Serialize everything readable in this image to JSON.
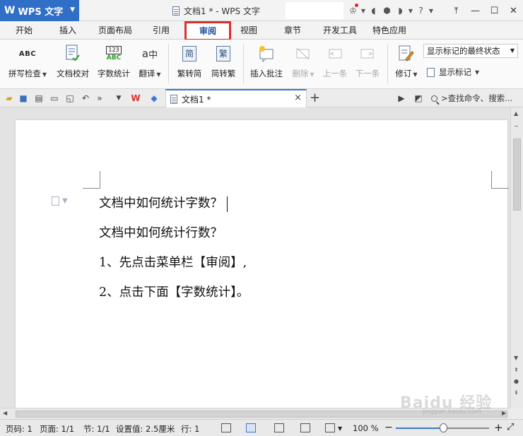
{
  "app": {
    "name": "WPS 文字",
    "logo": "W",
    "window_title": "文档1 * - WPS 文字"
  },
  "menu_tabs": [
    {
      "label": "开始"
    },
    {
      "label": "插入"
    },
    {
      "label": "页面布局"
    },
    {
      "label": "引用"
    },
    {
      "label": "审阅",
      "active": true
    },
    {
      "label": "视图"
    },
    {
      "label": "章节"
    },
    {
      "label": "开发工具"
    },
    {
      "label": "特色应用"
    }
  ],
  "ribbon": {
    "spell_check": "拼写检查",
    "proofread": "文档校对",
    "word_count": "字数统计",
    "translate": "翻译",
    "trad_to_simp": "繁转简",
    "simp_to_trad": "简转繁",
    "insert_comment": "插入批注",
    "delete": "删除",
    "prev": "上一条",
    "next": "下一条",
    "track_changes": "修订",
    "markup_state": "显示标记的最终状态",
    "show_markup": "显示标记",
    "icon_glyphs": {
      "spell_abc": "ABC",
      "count_num": "123",
      "count_abc": "ABC",
      "translate_a": "a",
      "translate_zh": "中",
      "trad_simp": "简",
      "simp_trad": "繁"
    }
  },
  "doc_tab": {
    "title": "文档1 *"
  },
  "search": {
    "placeholder": ">查找命令、搜索..."
  },
  "document": {
    "lines": [
      "文档中如何统计字数？",
      "文档中如何统计行数？",
      "1、先点击菜单栏【审阅】,",
      "2、点击下面【字数统计】。"
    ]
  },
  "status": {
    "page": "页码: 1",
    "pages": "页面: 1/1",
    "section": "节: 1/1",
    "setting": "设置值: 2.5厘米",
    "row": "行: 1",
    "zoom": "100 %",
    "zoom_minus": "−",
    "zoom_plus": "+"
  },
  "watermark": {
    "text": "Baidu 经验",
    "sub": "jingyan.baidu.com"
  },
  "colors": {
    "accent": "#2f6fc8",
    "highlight": "#d9312b",
    "tab_border": "#3a78d6"
  }
}
